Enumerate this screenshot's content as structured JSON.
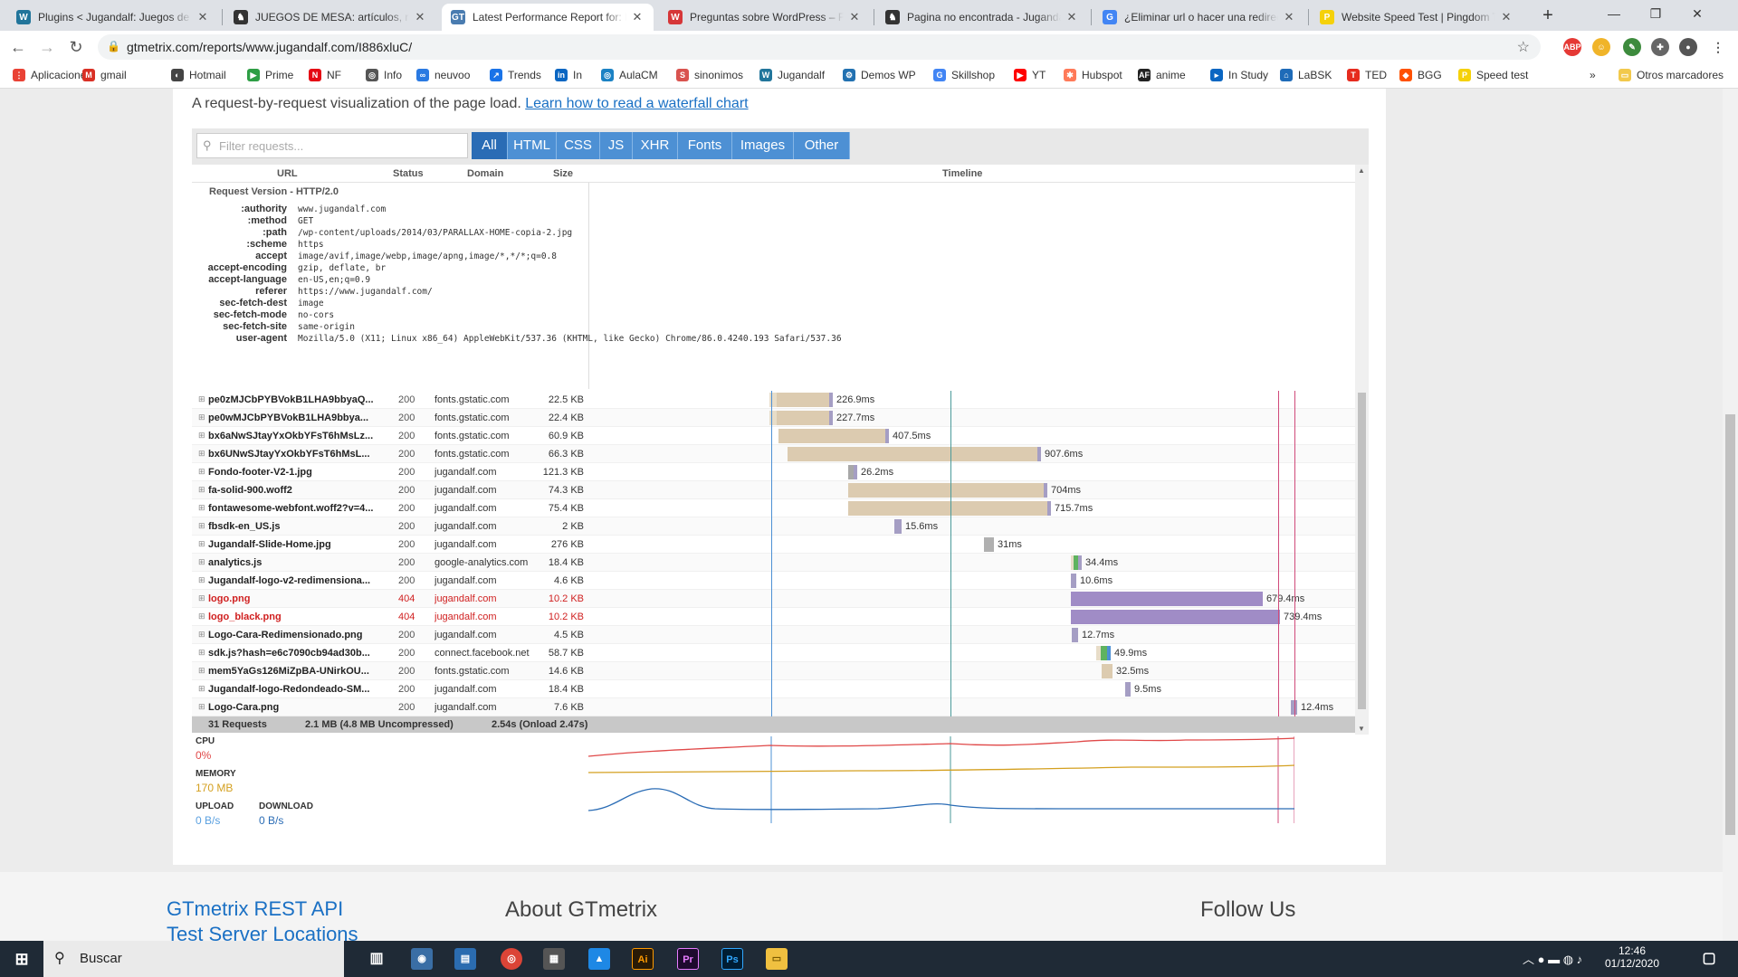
{
  "browser": {
    "tabs": [
      {
        "title": "Plugins < Jugandalf: Juegos de m",
        "icon": "wordpress-icon",
        "color": "#21759b",
        "glyph": "W"
      },
      {
        "title": "JUEGOS DE MESA: artículos, rese",
        "icon": "jugandalf-icon",
        "color": "#333333",
        "glyph": "♞"
      },
      {
        "title": "Latest Performance Report for: h",
        "icon": "gtmetrix-icon",
        "color": "#4a7cb0",
        "glyph": "GT"
      },
      {
        "title": "Preguntas sobre WordPress – For",
        "icon": "wordpress-red-icon",
        "color": "#d63638",
        "glyph": "W"
      },
      {
        "title": "Pagina no encontrada - Juganda",
        "icon": "jugandalf-icon",
        "color": "#333333",
        "glyph": "♞"
      },
      {
        "title": "¿Eliminar url o hacer una redirec",
        "icon": "google-icon",
        "color": "#4285f4",
        "glyph": "G"
      },
      {
        "title": "Website Speed Test | Pingdom To",
        "icon": "pingdom-icon",
        "color": "#f5d10a",
        "glyph": "P"
      }
    ],
    "url": "gtmetrix.com/reports/www.jugandalf.com/I886xluC/",
    "bookmarks": [
      {
        "label": "Aplicaciones",
        "color": "#e94235",
        "glyph": "⋮"
      },
      {
        "label": "gmail",
        "color": "#d93025",
        "glyph": "M"
      },
      {
        "label": "Hotmail",
        "color": "#444444",
        "glyph": "◐"
      },
      {
        "label": "Prime",
        "color": "#2e9e45",
        "glyph": "▶"
      },
      {
        "label": "NF",
        "color": "#e50914",
        "glyph": "N"
      },
      {
        "label": "Info",
        "color": "#555555",
        "glyph": "◎"
      },
      {
        "label": "neuvoo",
        "color": "#2a7ae2",
        "glyph": "∞"
      },
      {
        "label": "Trends",
        "color": "#1a73e8",
        "glyph": "↗"
      },
      {
        "label": "In",
        "color": "#0a66c2",
        "glyph": "in"
      },
      {
        "label": "AulaCM",
        "color": "#1b82c4",
        "glyph": "◎"
      },
      {
        "label": "sinonimos",
        "color": "#d9534f",
        "glyph": "S"
      },
      {
        "label": "Jugandalf",
        "color": "#21759b",
        "glyph": "W"
      },
      {
        "label": "Demos WP",
        "color": "#2271b1",
        "glyph": "⚙"
      },
      {
        "label": "Skillshop",
        "color": "#4285f4",
        "glyph": "G"
      },
      {
        "label": "YT",
        "color": "#ff0000",
        "glyph": "▶"
      },
      {
        "label": "Hubspot",
        "color": "#ff7a59",
        "glyph": "✱"
      },
      {
        "label": "anime",
        "color": "#222222",
        "glyph": "AF"
      },
      {
        "label": "In Study",
        "color": "#0a66c2",
        "glyph": "▸"
      },
      {
        "label": "LaBSK",
        "color": "#1e6bb8",
        "glyph": "⌂"
      },
      {
        "label": "TED",
        "color": "#e62b1e",
        "glyph": "T"
      },
      {
        "label": "BGG",
        "color": "#ff5100",
        "glyph": "◆"
      },
      {
        "label": "Speed test",
        "color": "#f5d10a",
        "glyph": "P"
      }
    ],
    "more_bookmarks": "»",
    "other_bookmarks": "Otros marcadores"
  },
  "page": {
    "description": "A request-by-request visualization of the page load.",
    "description_link": "Learn how to read a waterfall chart",
    "filter_placeholder": "Filter requests...",
    "filters": [
      "All",
      "HTML",
      "CSS",
      "JS",
      "XHR",
      "Fonts",
      "Images",
      "Other"
    ],
    "active_filter": "All",
    "columns": {
      "url": "URL",
      "status": "Status",
      "domain": "Domain",
      "size": "Size",
      "timeline": "Timeline"
    },
    "request_version": "Request Version - HTTP/2.0",
    "headers": [
      {
        "k": ":authority",
        "v": "www.jugandalf.com"
      },
      {
        "k": ":method",
        "v": "GET"
      },
      {
        "k": ":path",
        "v": "/wp-content/uploads/2014/03/PARALLAX-HOME-copia-2.jpg"
      },
      {
        "k": ":scheme",
        "v": "https"
      },
      {
        "k": "accept",
        "v": "image/avif,image/webp,image/apng,image/*,*/*;q=0.8"
      },
      {
        "k": "accept-encoding",
        "v": "gzip, deflate, br"
      },
      {
        "k": "accept-language",
        "v": "en-US,en;q=0.9"
      },
      {
        "k": "referer",
        "v": "https://www.jugandalf.com/"
      },
      {
        "k": "sec-fetch-dest",
        "v": "image"
      },
      {
        "k": "sec-fetch-mode",
        "v": "no-cors"
      },
      {
        "k": "sec-fetch-site",
        "v": "same-origin"
      },
      {
        "k": "user-agent",
        "v": "Mozilla/5.0 (X11; Linux x86_64) AppleWebKit/537.36 (KHTML, like Gecko) Chrome/86.0.4240.193 Safari/537.36"
      }
    ],
    "requests": [
      {
        "url": "pe0zMJCbPYBVokB1LHA9bbyaQ...",
        "status": "200",
        "domain": "fonts.gstatic.com",
        "size": "22.5 KB",
        "time": "226.9ms",
        "start": 200,
        "wait": 8,
        "recv": 58,
        "color": "#dccbb0",
        "mark": "#a59ec4"
      },
      {
        "url": "pe0wMJCbPYBVokB1LHA9bbya...",
        "status": "200",
        "domain": "fonts.gstatic.com",
        "size": "22.4 KB",
        "time": "227.7ms",
        "start": 200,
        "wait": 8,
        "recv": 58,
        "color": "#dccbb0",
        "mark": "#a59ec4"
      },
      {
        "url": "bx6aNwSJtayYxOkbYFsT6hMsLz...",
        "status": "200",
        "domain": "fonts.gstatic.com",
        "size": "60.9 KB",
        "time": "407.5ms",
        "start": 210,
        "wait": 0,
        "recv": 118,
        "color": "#dccbb0",
        "mark": "#a59ec4"
      },
      {
        "url": "bx6UNwSJtayYxOkbYFsT6hMsL...",
        "status": "200",
        "domain": "fonts.gstatic.com",
        "size": "66.3 KB",
        "time": "907.6ms",
        "start": 220,
        "wait": 0,
        "recv": 276,
        "color": "#dccbb0",
        "mark": "#a59ec4"
      },
      {
        "url": "Fondo-footer-V2-1.jpg",
        "status": "200",
        "domain": "jugandalf.com",
        "size": "121.3 KB",
        "time": "26.2ms",
        "start": 287,
        "wait": 0,
        "recv": 6,
        "color": "#a8a8a8",
        "mark": "#a59ec4"
      },
      {
        "url": "fa-solid-900.woff2",
        "status": "200",
        "domain": "jugandalf.com",
        "size": "74.3 KB",
        "time": "704ms",
        "start": 287,
        "wait": 0,
        "recv": 216,
        "color": "#dccbb0",
        "mark": "#a59ec4"
      },
      {
        "url": "fontawesome-webfont.woff2?v=4...",
        "status": "200",
        "domain": "jugandalf.com",
        "size": "75.4 KB",
        "time": "715.7ms",
        "start": 287,
        "wait": 0,
        "recv": 220,
        "color": "#dccbb0",
        "mark": "#a59ec4"
      },
      {
        "url": "fbsdk-en_US.js",
        "status": "200",
        "domain": "jugandalf.com",
        "size": "2 KB",
        "time": "15.6ms",
        "start": 338,
        "wait": 0,
        "recv": 4,
        "color": "#a59ec4",
        "mark": "#a59ec4"
      },
      {
        "url": "Jugandalf-Slide-Home.jpg",
        "status": "200",
        "domain": "jugandalf.com",
        "size": "276 KB",
        "time": "31ms",
        "start": 437,
        "wait": 0,
        "recv": 7,
        "color": "#b0b0b0",
        "mark": "#b0b0b0"
      },
      {
        "url": "analytics.js",
        "status": "200",
        "domain": "google-analytics.com",
        "size": "18.4 KB",
        "time": "34.4ms",
        "start": 533,
        "wait": 3,
        "recv": 5,
        "color": "#5fb35f",
        "mark": "#a59ec4"
      },
      {
        "url": "Jugandalf-logo-v2-redimensiona...",
        "status": "200",
        "domain": "jugandalf.com",
        "size": "4.6 KB",
        "time": "10.6ms",
        "start": 533,
        "wait": 0,
        "recv": 2,
        "color": "#a59ec4",
        "mark": "#a59ec4"
      },
      {
        "url": "logo.png",
        "status": "404",
        "domain": "jugandalf.com",
        "size": "10.2 KB",
        "time": "679.4ms",
        "start": 533,
        "wait": 0,
        "recv": 208,
        "color": "#a08cc6",
        "mark": "#a08cc6",
        "error": true
      },
      {
        "url": "logo_black.png",
        "status": "404",
        "domain": "jugandalf.com",
        "size": "10.2 KB",
        "time": "739.4ms",
        "start": 533,
        "wait": 0,
        "recv": 227,
        "color": "#a08cc6",
        "mark": "#a08cc6",
        "error": true
      },
      {
        "url": "Logo-Cara-Redimensionado.png",
        "status": "200",
        "domain": "jugandalf.com",
        "size": "4.5 KB",
        "time": "12.7ms",
        "start": 534,
        "wait": 0,
        "recv": 3,
        "color": "#a59ec4",
        "mark": "#a59ec4"
      },
      {
        "url": "sdk.js?hash=e6c7090cb94ad30b...",
        "status": "200",
        "domain": "connect.facebook.net",
        "size": "58.7 KB",
        "time": "49.9ms",
        "start": 561,
        "wait": 5,
        "recv": 7,
        "color": "#5fb35f",
        "mark": "#4d90d4"
      },
      {
        "url": "mem5YaGs126MiZpBA-UNirkOU...",
        "status": "200",
        "domain": "fonts.gstatic.com",
        "size": "14.6 KB",
        "time": "32.5ms",
        "start": 567,
        "wait": 0,
        "recv": 8,
        "color": "#dccbb0",
        "mark": "#dccbb0"
      },
      {
        "url": "Jugandalf-logo-Redondeado-SM...",
        "status": "200",
        "domain": "jugandalf.com",
        "size": "18.4 KB",
        "time": "9.5ms",
        "start": 593,
        "wait": 0,
        "recv": 2,
        "color": "#a59ec4",
        "mark": "#a59ec4"
      },
      {
        "url": "Logo-Cara.png",
        "status": "200",
        "domain": "jugandalf.com",
        "size": "7.6 KB",
        "time": "12.4ms",
        "start": 776,
        "wait": 0,
        "recv": 3,
        "color": "#a59ec4",
        "mark": "#a59ec4"
      }
    ],
    "summary": {
      "requests": "31 Requests",
      "size": "2.1 MB (4.8 MB Uncompressed)",
      "time": "2.54s (Onload 2.47s)"
    },
    "metrics": {
      "cpu_label": "CPU",
      "cpu_value": "0%",
      "memory_label": "MEMORY",
      "memory_value": "170 MB",
      "upload_label": "UPLOAD",
      "upload_value": "0 B/s",
      "download_label": "DOWNLOAD",
      "download_value": "0 B/s"
    },
    "footer": {
      "col1": "GTmetrix REST API",
      "col1b": "Test Server Locations",
      "col2": "About GTmetrix",
      "col3": "Follow Us"
    }
  },
  "taskbar": {
    "search_placeholder": "Buscar",
    "time": "12:46",
    "date": "01/12/2020"
  }
}
